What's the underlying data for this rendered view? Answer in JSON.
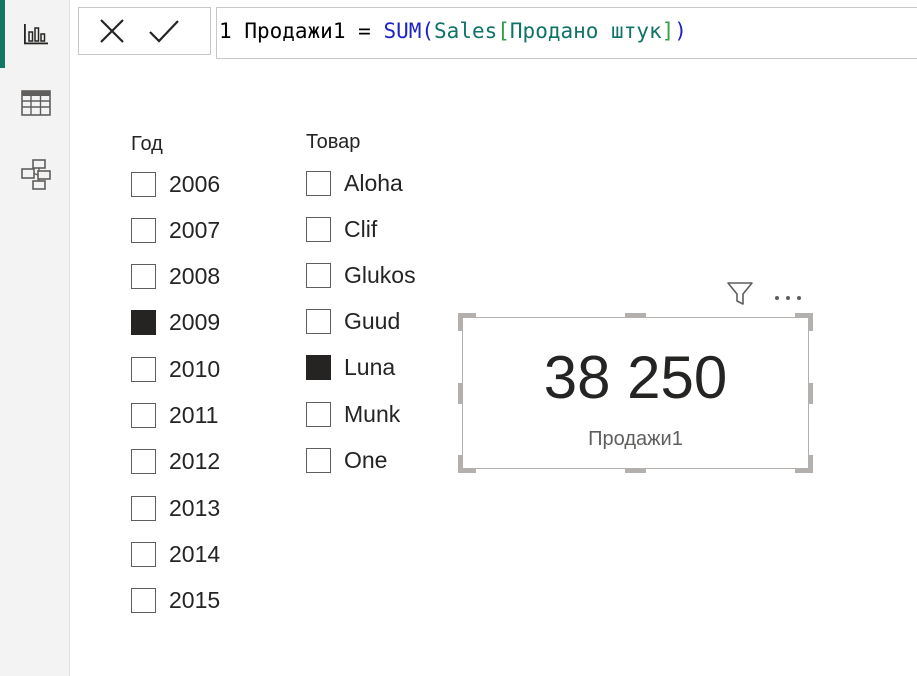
{
  "nav": {
    "items": [
      {
        "name": "report-view",
        "icon": "bar-chart-icon",
        "active": true
      },
      {
        "name": "table-view",
        "icon": "table-grid-icon",
        "active": false
      },
      {
        "name": "model-view",
        "icon": "model-diagram-icon",
        "active": false
      }
    ],
    "accent_color": "#117865"
  },
  "formula_bar": {
    "cancel_icon": "close-icon",
    "commit_icon": "checkmark-icon",
    "line_number": "1",
    "measure_name": "Продажи1",
    "operator": "=",
    "function": "SUM",
    "open_paren": "(",
    "table": "Sales",
    "open_bracket": "[",
    "column": "Продано штук",
    "close_bracket": "]",
    "close_paren": ")",
    "colors": {
      "function": "#1b22c9",
      "table": "#0f7368",
      "bracket": "#31a24a"
    }
  },
  "slicer_year": {
    "title": "Год",
    "items": [
      {
        "label": "2006",
        "checked": false
      },
      {
        "label": "2007",
        "checked": false
      },
      {
        "label": "2008",
        "checked": false
      },
      {
        "label": "2009",
        "checked": true
      },
      {
        "label": "2010",
        "checked": false
      },
      {
        "label": "2011",
        "checked": false
      },
      {
        "label": "2012",
        "checked": false
      },
      {
        "label": "2013",
        "checked": false
      },
      {
        "label": "2014",
        "checked": false
      },
      {
        "label": "2015",
        "checked": false
      }
    ]
  },
  "slicer_product": {
    "title": "Товар",
    "items": [
      {
        "label": "Aloha",
        "checked": false
      },
      {
        "label": "Clif",
        "checked": false
      },
      {
        "label": "Glukos",
        "checked": false
      },
      {
        "label": "Guud",
        "checked": false
      },
      {
        "label": "Luna",
        "checked": true
      },
      {
        "label": "Munk",
        "checked": false
      },
      {
        "label": "One",
        "checked": false
      }
    ]
  },
  "card": {
    "value": "38 250",
    "label": "Продажи1",
    "header_icons": [
      "filter-icon",
      "more-options-icon"
    ]
  }
}
